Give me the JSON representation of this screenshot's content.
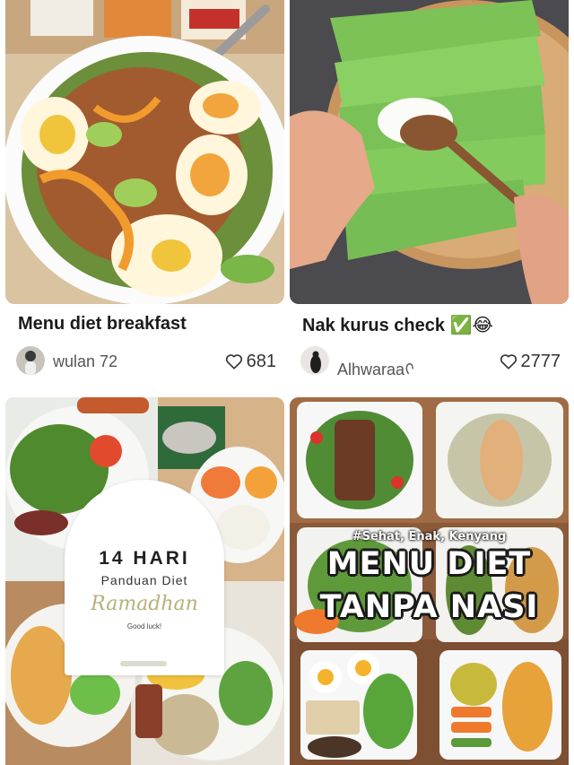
{
  "feed": {
    "cards": [
      {
        "title": "Menu diet breakfast",
        "author": "wulan 72",
        "likes": "681",
        "image_desc_icon": "salad-bowl-photo"
      },
      {
        "title": "Nak kurus check",
        "title_emoji": "✅😂",
        "author": "Alhwaraa",
        "author_suffix": "ᢉ",
        "likes": "2777",
        "image_desc_icon": "lettuce-wrap-photo"
      },
      {
        "image_desc_icon": "ramadhan-diet-collage-photo",
        "overlay": {
          "line1": "14 HARI",
          "line2": "Panduan Diet",
          "line3": "Ramadhan",
          "line4": "Good luck!"
        }
      },
      {
        "image_desc_icon": "diet-menu-collage-photo",
        "overlay": {
          "tagline": "#Sehat, Enak, Kenyang",
          "line1": "MENU DIET",
          "line2": "TANPA NASI"
        }
      }
    ]
  },
  "colors": {
    "title": "#1b1b1b",
    "meta": "#555555",
    "like_outline": "#333333",
    "ramadhan_script": "#b8b07a"
  }
}
